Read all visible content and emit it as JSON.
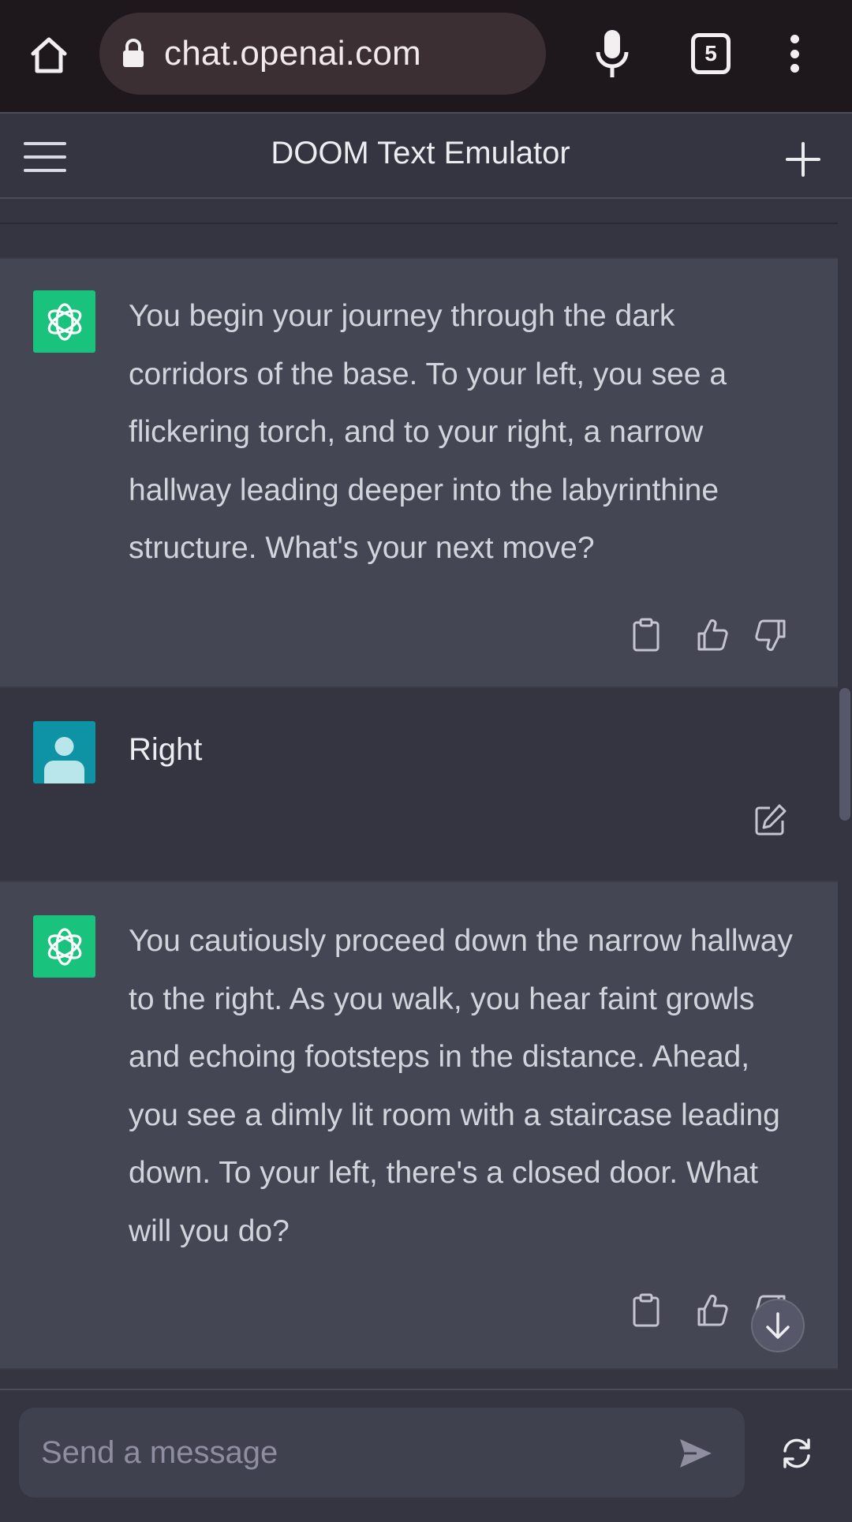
{
  "browser": {
    "url": "chat.openai.com",
    "tab_count": "5"
  },
  "header": {
    "title": "DOOM Text Emulator"
  },
  "messages": [
    {
      "role": "assistant",
      "text": "You begin your journey through the dark corridors of the base. To your left, you see a flickering torch, and to your right, a narrow hallway leading deeper into the labyrinthine structure. What's your next move?"
    },
    {
      "role": "user",
      "text": "Right"
    },
    {
      "role": "assistant",
      "text": "You cautiously proceed down the narrow hallway to the right. As you walk, you hear faint growls and echoing footsteps in the distance. Ahead, you see a dimly lit room with a staircase leading down. To your left, there's a closed door. What will you do?"
    }
  ],
  "composer": {
    "placeholder": "Send a message",
    "value": ""
  },
  "colors": {
    "assistant_bg": "#444654",
    "user_bg": "#343541",
    "gpt_avatar": "#19c37d",
    "user_avatar": "#0d93a3",
    "browser_bar": "#1e181c"
  },
  "icons": {
    "home": "home-icon",
    "lock": "lock-icon",
    "mic": "mic-icon",
    "tabs": "tabs-icon",
    "more": "more-vert-icon",
    "menu": "hamburger-icon",
    "new_chat": "plus-icon",
    "copy": "clipboard-icon",
    "thumbs_up": "thumbs-up-icon",
    "thumbs_down": "thumbs-down-icon",
    "edit": "edit-icon",
    "send": "send-icon",
    "regenerate": "regenerate-icon",
    "scroll_down": "arrow-down-icon"
  }
}
